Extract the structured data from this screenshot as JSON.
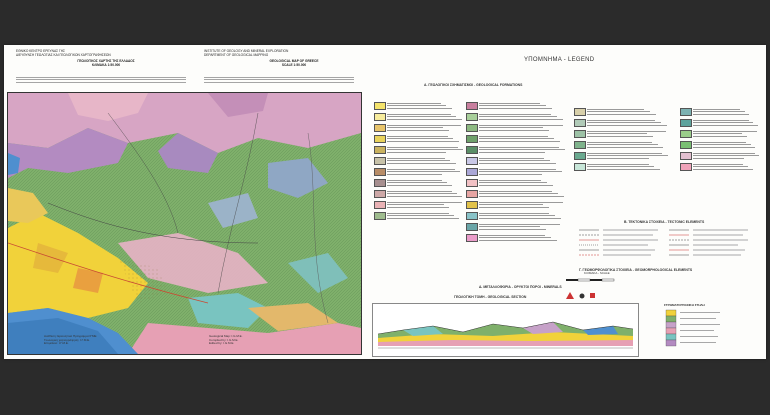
{
  "header": {
    "left": {
      "lines": [
        "ΕΘΝΙΚΟ ΚΕΝΤΡΟ ΕΡΕΥΝΑΣ ΓΗΣ",
        "ΔΙΕΥΘΥΝΣΗ ΓΕΩΛΟΓΙΑΣ ΚΑΙ ΓΕΩΛΟΓΙΚΩΝ ΧΑΡΤΟΓΡΑΦΗΣΕΩΝ",
        "ΓΕΩΛΟΓΙΚΟΣ ΧΑΡΤΗΣ ΤΗΣ ΕΛΛΑΔΟΣ",
        "ΚΛΙΜΑΚΑ 1:50.000"
      ],
      "title": "ΓΕΩΛΟΓΙΚΟΣ ΧΑΡΤΗΣ ΤΗΣ ΕΛΛΑΔΟΣ",
      "scale": "ΚΛΙΜΑΚΑ 1:50.000"
    },
    "right": {
      "lines": [
        "INSTITUTE OF GEOLOGY AND MINERAL EXPLORATION",
        "DEPARTMENT OF GEOLOGICAL MAPPING",
        "GEOLOGICAL MAP OF GREECE",
        "SCALE 1:50.000"
      ],
      "title": "GEOLOGICAL MAP OF GREECE",
      "scale": "SCALE 1:50.000"
    }
  },
  "legend": {
    "title": "ΥΠΟΜΝΗΜΑ - LEGEND",
    "section_a": "Α. ΓΕΩΛΟΓΙΚΟΙ ΣΧΗΜΑΤΙΣΜΟΙ - GEOLOGICAL FORMATIONS",
    "section_b": "Β. ΤΕΚΤΟΝΙΚΑ ΣΤΟΙΧΕΙΑ - TECTONIC ELEMENTS",
    "section_c": "Γ. ΓΕΩΜΟΡΦΟΛΟΓΙΚΑ ΣΤΟΙΧΕΙΑ - GEOMORPHOLOGICAL ELEMENTS",
    "section_d": "Δ. ΜΕΤΑΛΛΟΦΟΡΙΑ - ΟΡΥΚΤΟΙ ΠΟΡΟΙ - MINERALS",
    "col1_colors": [
      "#f4e36b",
      "#f7ec9c",
      "#e8c46a",
      "#e9d35b",
      "#c9b25f",
      "#c7c2a9",
      "#b88d67",
      "#a78f8f",
      "#cda8a7",
      "#e9b2b5",
      "#9fbc8e"
    ],
    "col2_colors": [
      "#c87f9e",
      "#a8cf9a",
      "#8db981",
      "#6fa16b",
      "#5b8f67",
      "#c9c8e6",
      "#aaa7d6",
      "#f1c1c4",
      "#e7a5a3",
      "#e1c24a",
      "#89c3c8",
      "#6aa6a8",
      "#ea9cc9"
    ],
    "col3_colors": [
      "#d8d0aa",
      "#b1cbb8",
      "#9dc2a6",
      "#7fb38c",
      "#6aa98f",
      "#c7e6d8"
    ],
    "col4_colors": [
      "#7db2b2",
      "#5da39c",
      "#9acd8a",
      "#7abf73",
      "#e3c0d0",
      "#f0a3b9"
    ]
  },
  "footer": {
    "left": [
      "Ανάθεση: Ερευνητικό Πρόγραμμα ΙΓΜΕ",
      "Γεωλογική χαρτογράφηση: Ι.Γ.Μ.Ε.",
      "Επιμέλεια: Ι.Γ.Μ.Ε."
    ],
    "right": [
      "Geological Map: I.G.M.E.",
      "Compiled by: I.G.M.E.",
      "Edited by: I.G.M.E."
    ]
  },
  "scale_bar": {
    "label": "ΚΛΙΜΑΚΑ - SCALE",
    "ratio": "1:50.000",
    "ticks": [
      "0",
      "1",
      "2",
      "3 km"
    ]
  },
  "section": {
    "title": "ΓΕΩΛΟΓΙΚΗ ΤΟΜΗ - GEOLOGICAL SECTION",
    "strat_title": "ΣΤΡΩΜΑΤΟΓΡΑΦΙΚΗ ΣΤΗΛΗ"
  },
  "colors": {
    "sea": "#4f8fcf",
    "neogene": "#f1d23a",
    "flysch": "#7cb06a",
    "limestone": "#c6a1c8",
    "schist": "#e6a0b4"
  }
}
